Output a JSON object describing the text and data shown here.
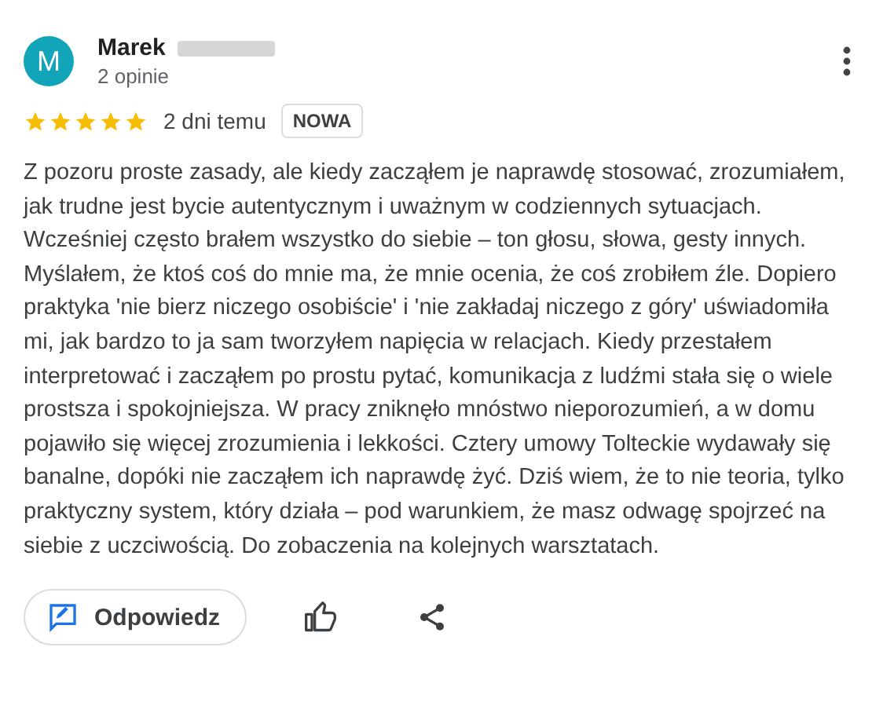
{
  "review": {
    "avatar_letter": "M",
    "name": "Marek",
    "review_count": "2 opinie",
    "stars": 5,
    "time": "2 dni temu",
    "badge": "NOWA",
    "text": "Z pozoru proste zasady, ale kiedy zacząłem je naprawdę stosować, zrozumiałem, jak trudne jest bycie autentycznym i uważnym w codziennych sytuacjach. Wcześniej często brałem wszystko do siebie – ton głosu, słowa, gesty innych. Myślałem, że ktoś coś do mnie ma, że mnie ocenia, że coś zrobiłem źle. Dopiero praktyka 'nie bierz niczego osobiście' i 'nie zakładaj niczego z góry' uświadomiła mi, jak bardzo to ja sam tworzyłem napięcia w relacjach. Kiedy przestałem interpretować i zacząłem po prostu pytać, komunikacja z ludźmi stała się o wiele prostsza i spokojniejsza. W pracy zniknęło mnóstwo nieporozumień, a w domu pojawiło się więcej zrozumienia i lekkości. Cztery umowy Tolteckie wydawały się banalne, dopóki nie zacząłem ich naprawdę żyć. Dziś wiem, że to nie teoria, tylko praktyczny system, który działa – pod warunkiem, że masz odwagę spojrzeć na siebie z uczciwością. Do zobaczenia na kolejnych warsztatach."
  },
  "actions": {
    "reply": "Odpowiedz"
  }
}
